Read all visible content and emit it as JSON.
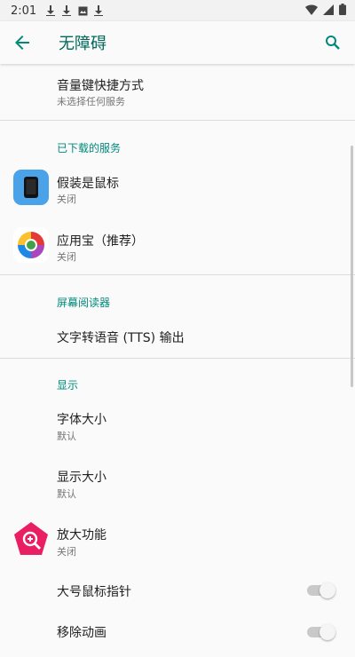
{
  "status_bar": {
    "time": "2:01"
  },
  "app_bar": {
    "title": "无障碍",
    "accent": "#00897b"
  },
  "items": {
    "volume_shortcut": {
      "title": "音量键快捷方式",
      "subtitle": "未选择任何服务"
    },
    "section_downloaded": "已下载的服务",
    "fake_mouse": {
      "title": "假装是鼠标",
      "subtitle": "关闭"
    },
    "app_store": {
      "title": "应用宝（推荐）",
      "subtitle": "关闭"
    },
    "section_screen_reader": "屏幕阅读器",
    "tts": {
      "title": "文字转语音 (TTS) 输出"
    },
    "section_display": "显示",
    "font_size": {
      "title": "字体大小",
      "subtitle": "默认"
    },
    "display_size": {
      "title": "显示大小",
      "subtitle": "默认"
    },
    "magnification": {
      "title": "放大功能",
      "subtitle": "关闭"
    },
    "large_pointer": {
      "title": "大号鼠标指针",
      "toggle_on": false
    },
    "remove_animations": {
      "title": "移除动画",
      "toggle_on": false
    }
  }
}
